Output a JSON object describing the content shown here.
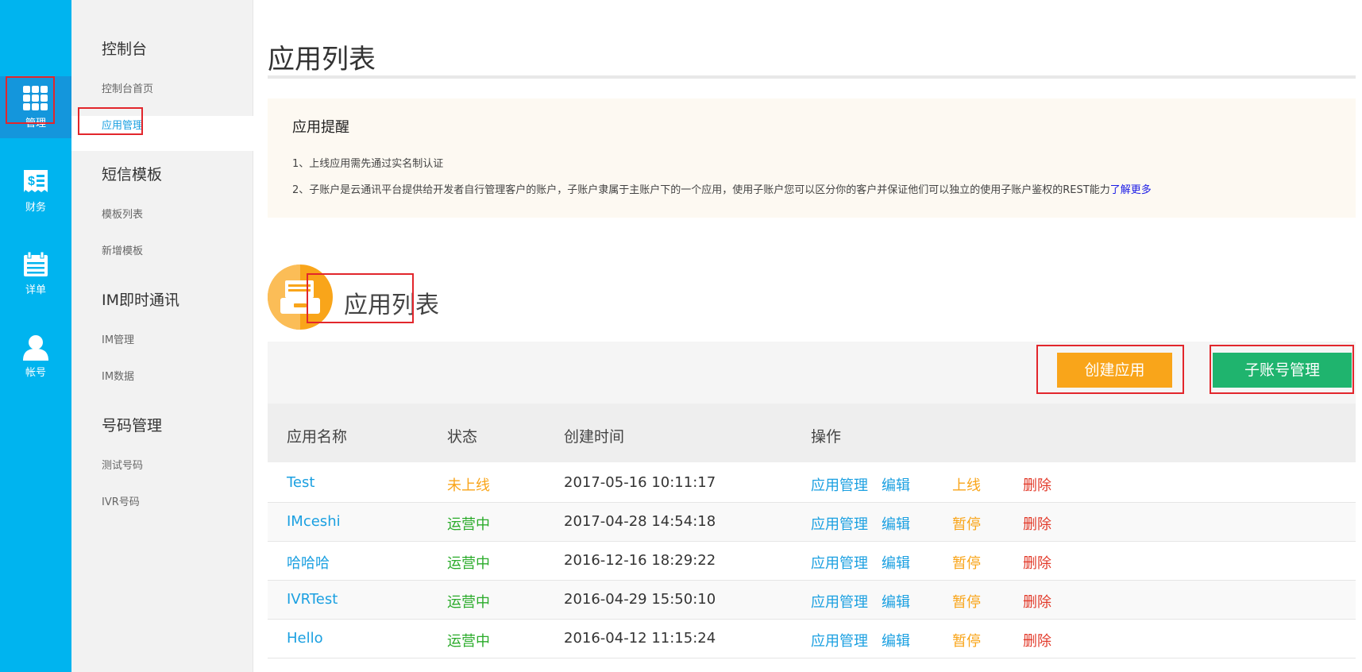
{
  "rail": {
    "items": [
      {
        "label": "管理",
        "icon": "grid-icon"
      },
      {
        "label": "财务",
        "icon": "finance-icon"
      },
      {
        "label": "详单",
        "icon": "calendar-icon"
      },
      {
        "label": "帐号",
        "icon": "user-icon"
      }
    ],
    "active_color": "#1496dc",
    "bg_color": "#00b4ef"
  },
  "subnav": {
    "groups": [
      {
        "title": "控制台",
        "items": [
          "控制台首页",
          "应用管理"
        ]
      },
      {
        "title": "短信模板",
        "items": [
          "模板列表",
          "新增模板"
        ]
      },
      {
        "title": "IM即时通讯",
        "items": [
          "IM管理",
          "IM数据"
        ]
      },
      {
        "title": "号码管理",
        "items": [
          "测试号码",
          "IVR号码"
        ]
      }
    ],
    "active_item": "应用管理"
  },
  "main": {
    "page_title": "应用列表",
    "notice": {
      "title": "应用提醒",
      "lines": [
        "1、上线应用需先通过实名制认证",
        "2、子账户是云通讯平台提供给开发者自行管理客户的账户，子账户隶属于主账户下的一个应用，使用子账户您可以区分你的客户并保证他们可以独立的使用子账户鉴权的REST能力"
      ],
      "learn_more": "了解更多"
    },
    "list_heading": "应用列表",
    "buttons": {
      "create": "创建应用",
      "subaccount": "子账号管理"
    },
    "table": {
      "headers": [
        "应用名称",
        "状态",
        "创建时间",
        "操作"
      ],
      "rows": [
        {
          "name": "Test",
          "status": "未上线",
          "created": "2017-05-16 10:11:17",
          "manage": "应用管理",
          "edit": "编辑",
          "toggle": "上线",
          "delete": "删除"
        },
        {
          "name": "IMceshi",
          "status": "运营中",
          "created": "2017-04-28 14:54:18",
          "manage": "应用管理",
          "edit": "编辑",
          "toggle": "暂停",
          "delete": "删除"
        },
        {
          "name": "哈哈哈",
          "status": "运营中",
          "created": "2016-12-16 18:29:22",
          "manage": "应用管理",
          "edit": "编辑",
          "toggle": "暂停",
          "delete": "删除"
        },
        {
          "name": "IVRTest",
          "status": "运营中",
          "created": "2016-04-29 15:50:10",
          "manage": "应用管理",
          "edit": "编辑",
          "toggle": "暂停",
          "delete": "删除"
        },
        {
          "name": "Hello",
          "status": "运营中",
          "created": "2016-04-12 11:15:24",
          "manage": "应用管理",
          "edit": "编辑",
          "toggle": "暂停",
          "delete": "删除"
        }
      ]
    }
  },
  "colors": {
    "accent_blue": "#1ba0e1",
    "create_button": "#f9a51a",
    "subaccount_button": "#1fb46e",
    "status_offline": "#f9a51a",
    "status_online": "#2aab2a",
    "delete": "#e23a2a",
    "highlight_box": "#e2262c"
  }
}
